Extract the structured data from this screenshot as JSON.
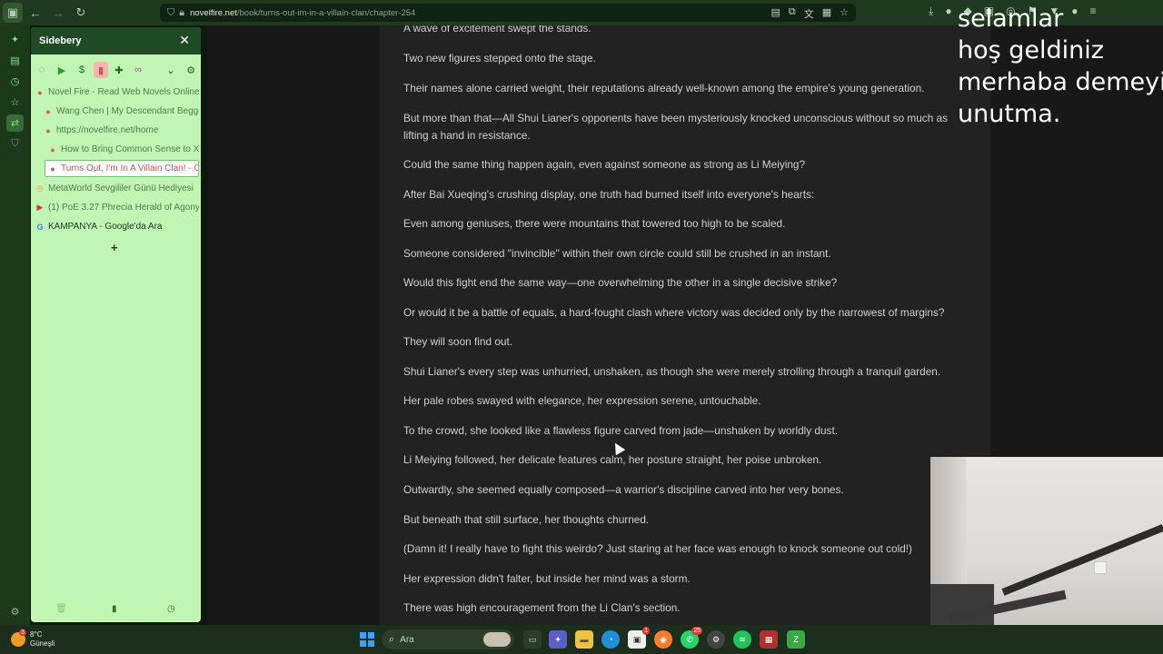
{
  "browser": {
    "url_host": "novelfire.net",
    "url_path": "/book/turns-out-im-in-a-villain-clan/chapter-254"
  },
  "sidebery": {
    "title": "Sidebery",
    "tabs": [
      {
        "label": "Novel Fire - Read Web Novels Online"
      },
      {
        "label": "Wang Chen | My Descendant Begged"
      },
      {
        "label": "https://novelfire.net/home"
      },
      {
        "label": "How to Bring Common Sense to X"
      },
      {
        "label": "Turns Out, I'm In A Villain Clan! - C"
      },
      {
        "label": "MetaWorld Sevgililer Günü Hediyesi"
      },
      {
        "label": "(1) PoE 3.27 Phrecia Herald of Agony"
      },
      {
        "label": "KAMPANYA - Google'da Ara"
      }
    ],
    "panel_badges": [
      "1",
      "17",
      "9",
      "7"
    ]
  },
  "article": {
    "paragraphs": [
      "A wave of excitement swept the stands.",
      "Two new figures stepped onto the stage.",
      "Their names alone carried weight, their reputations already well-known among the empire's young generation.",
      "But more than that—All Shui Lianer's opponents have been mysteriously knocked unconscious without so much as",
      "lifting a hand in resistance.",
      "Could the same thing happen again, even against someone as strong as Li Meiying?",
      "After Bai Xueqing's crushing display, one truth had burned itself into everyone's hearts:",
      "Even among geniuses, there were mountains that towered too high to be scaled.",
      "Someone considered \"invincible\" within their own circle could still be crushed in an instant.",
      "Would this fight end the same way—one overwhelming the other in a single decisive strike?",
      "Or would it be a battle of equals, a hard-fought clash where victory was decided only by the narrowest of margins?",
      "They will soon find out.",
      "Shui Lianer's every step was unhurried, unshaken, as though she were merely strolling through a tranquil garden.",
      "Her pale robes swayed with elegance, her expression serene, untouchable.",
      "To the crowd, she looked like a flawless figure carved from jade—unshaken by worldly dust.",
      "Li Meiying followed, her delicate features calm, her posture straight, her poise unbroken.",
      "Outwardly, she seemed equally composed—a warrior's discipline carved into her very bones.",
      "But beneath that still surface, her thoughts churned.",
      "(Damn it! I really have to fight this weirdo? Just staring at her face was enough to knock someone out cold!)",
      "Her expression didn't falter, but inside her mind was a storm.",
      "There was high encouragement from the Li Clan's section."
    ]
  },
  "overlay": {
    "lines": [
      "selamlar",
      "hoş geldiniz",
      "merhaba demeyi",
      "unutma."
    ]
  },
  "taskbar": {
    "weather_temp": "8°C",
    "weather_desc": "Güneşli",
    "weather_badge": "3",
    "search_label": "Ara",
    "badges": {
      "store": "1",
      "firefox": "",
      "whatsapp": "25"
    }
  }
}
